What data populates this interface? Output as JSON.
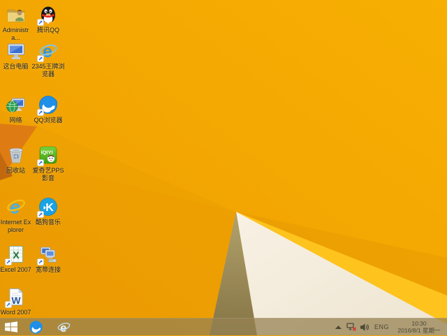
{
  "wallpaper": {
    "base_orange_left": "#ef9e03",
    "base_orange_right": "#f7af02",
    "gold_stripe": "#fec41d",
    "white_facet": "#f4ede0",
    "khaki_facet": "#a3925e",
    "dark_wedge": "#de7c13"
  },
  "desktop": {
    "icons": [
      {
        "id": "administrator-folder",
        "label": "Administra..."
      },
      {
        "id": "tencent-qq",
        "label": "腾讯QQ"
      },
      {
        "id": "this-pc",
        "label": "这台电脑"
      },
      {
        "id": "2345-browser",
        "label": "2345王牌浏览器"
      },
      {
        "id": "network",
        "label": "网络"
      },
      {
        "id": "qq-browser",
        "label": "QQ浏览器"
      },
      {
        "id": "recycle-bin",
        "label": "回收站"
      },
      {
        "id": "iqiyi-pps",
        "label": "爱奇艺PPS影音"
      },
      {
        "id": "internet-explorer",
        "label": "Internet Explorer"
      },
      {
        "id": "kugou-music",
        "label": "酷狗音乐"
      },
      {
        "id": "excel-2007",
        "label": "Excel 2007"
      },
      {
        "id": "broadband-connection",
        "label": "宽带连接"
      },
      {
        "id": "word-2007",
        "label": "Word 2007"
      }
    ]
  },
  "taskbar": {
    "pinned": [
      "qq-browser",
      "2345-browser"
    ],
    "tray": {
      "icons": [
        "show-hidden-icons",
        "network-disconnected",
        "volume"
      ],
      "language": "ENG",
      "time": "10:30",
      "date": "2016/8/1 星期一"
    }
  },
  "colors": {
    "taskbar_tint": "rgba(150,130,82,0.74)",
    "desktop_label_text": "#1c1c1c",
    "tray_text": "#4e4936"
  }
}
